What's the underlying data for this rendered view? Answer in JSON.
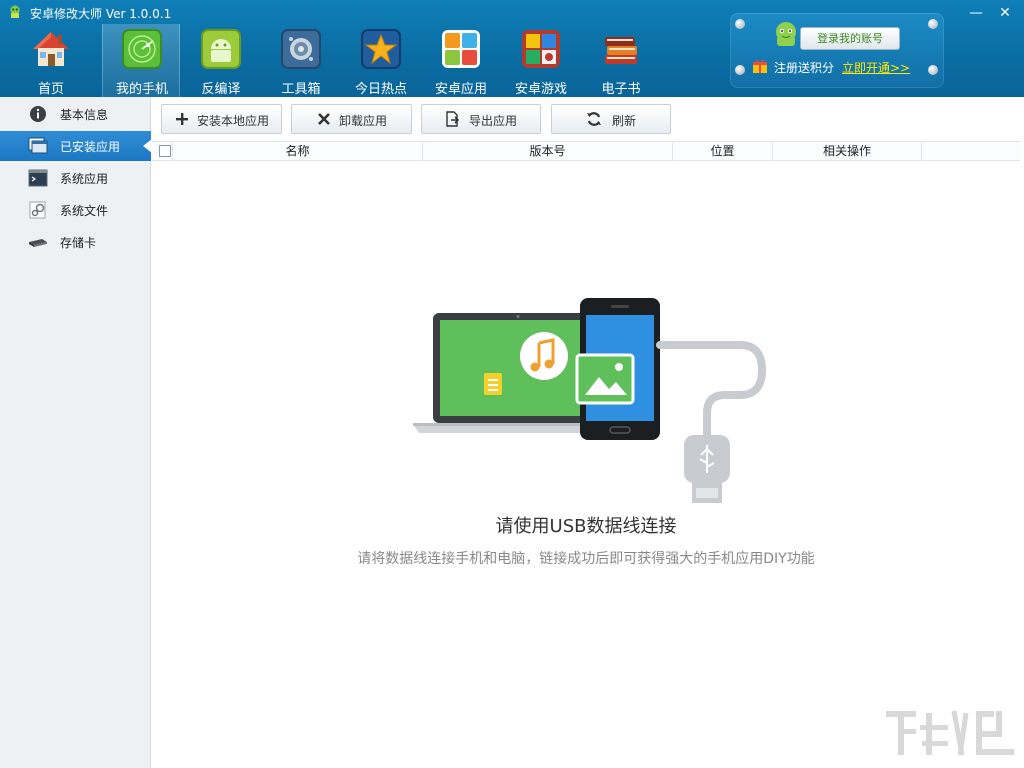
{
  "window": {
    "title": "安卓修改大师 Ver 1.0.0.1",
    "controls": {
      "minimize": "—",
      "close": "✕"
    }
  },
  "nav": {
    "items": [
      {
        "label": "首页",
        "icon": "house-icon"
      },
      {
        "label": "我的手机",
        "icon": "radar-phone-icon",
        "active": true
      },
      {
        "label": "反编译",
        "icon": "android-box-icon"
      },
      {
        "label": "工具箱",
        "icon": "gear-box-icon"
      },
      {
        "label": "今日热点",
        "icon": "star-icon"
      },
      {
        "label": "安卓应用",
        "icon": "app-tiles-icon"
      },
      {
        "label": "安卓游戏",
        "icon": "game-cube-icon"
      },
      {
        "label": "电子书",
        "icon": "books-icon"
      }
    ]
  },
  "account": {
    "login_label": "登录我的账号",
    "points_text": "注册送积分",
    "open_link": "立即开通>>"
  },
  "sidebar": {
    "items": [
      {
        "label": "基本信息",
        "icon": "info-icon"
      },
      {
        "label": "已安装应用",
        "icon": "installed-apps-icon",
        "active": true
      },
      {
        "label": "系统应用",
        "icon": "system-app-icon"
      },
      {
        "label": "系统文件",
        "icon": "system-files-icon"
      },
      {
        "label": "存储卡",
        "icon": "sd-card-icon"
      }
    ]
  },
  "toolbar": {
    "install_label": "安装本地应用",
    "uninstall_label": "卸载应用",
    "export_label": "导出应用",
    "refresh_label": "刷新"
  },
  "table": {
    "columns": [
      "名称",
      "版本号",
      "位置",
      "相关操作"
    ]
  },
  "empty_state": {
    "title": "请使用USB数据线连接",
    "subtitle": "请将数据线连接手机和电脑，链接成功后即可获得强大的手机应用DIY功能"
  },
  "colors": {
    "header_blue": "#0a6ea3",
    "sidebar_active": "#1c77c2",
    "link_yellow": "#ffea00",
    "screen_green": "#5fbf5a",
    "phone_blue": "#2f8fe0"
  }
}
